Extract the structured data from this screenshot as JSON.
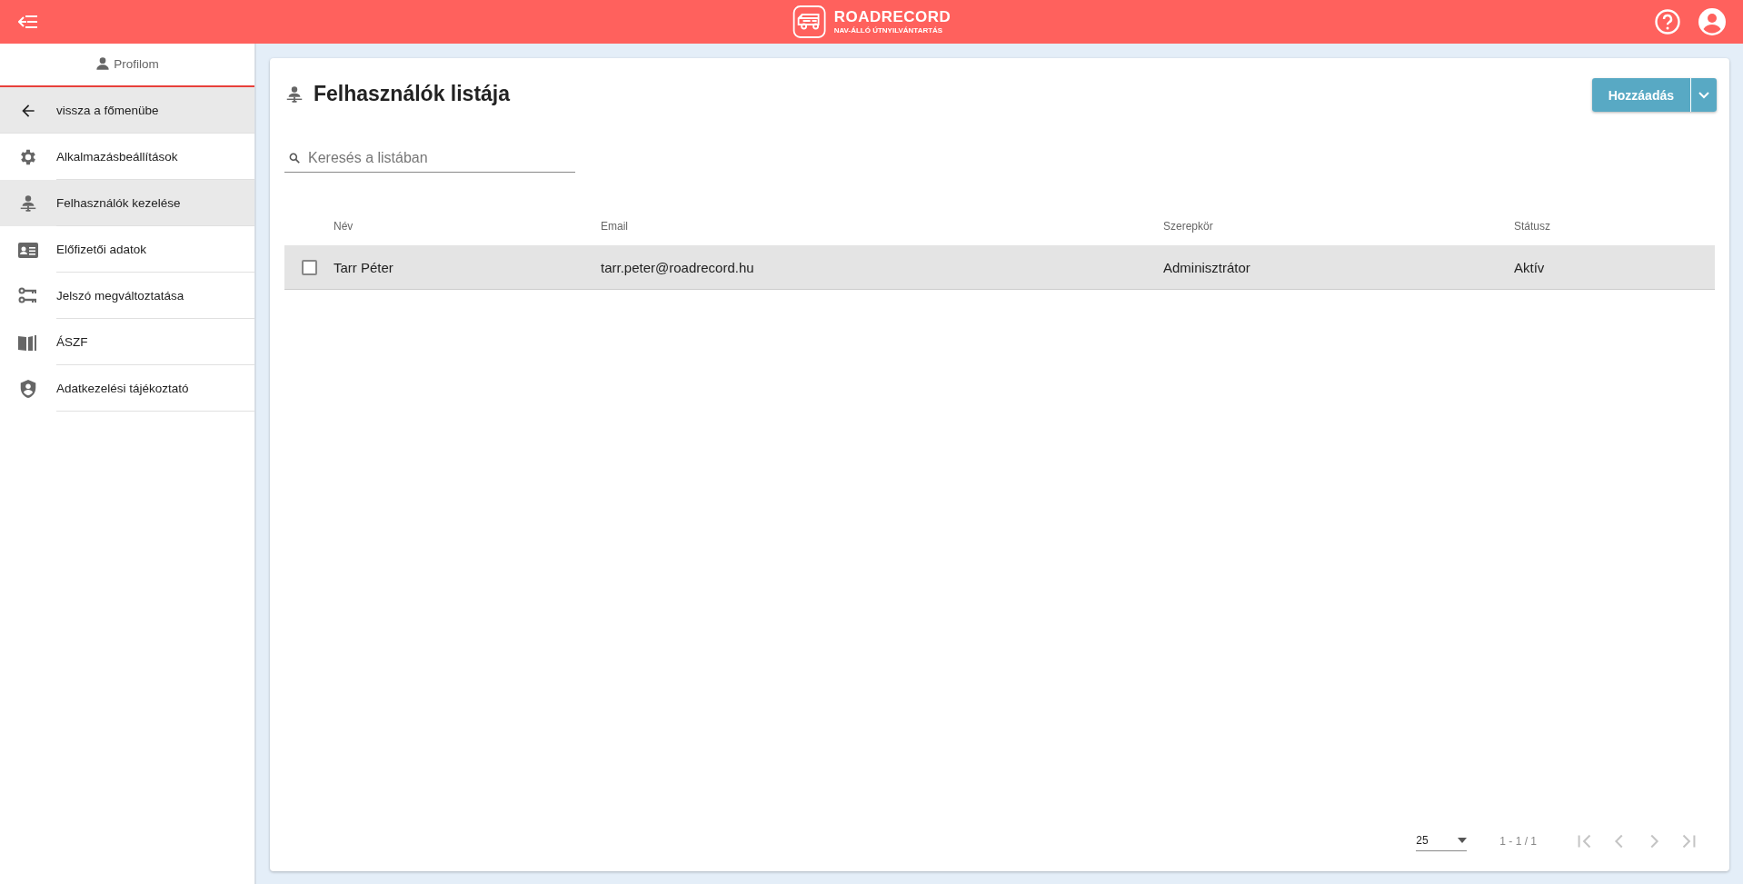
{
  "topbar": {
    "brand": "ROADRECORD",
    "tagline": "NAV-ÁLLÓ ÚTNYILVÁNTARTÁS"
  },
  "sidebar": {
    "header": "Profilom",
    "items": [
      {
        "label": "vissza a főmenübe",
        "kind": "back",
        "selected": true
      },
      {
        "label": "Alkalmazásbeállítások",
        "kind": "link",
        "selected": false
      },
      {
        "label": "Felhasználók kezelése",
        "kind": "link",
        "selected": true
      },
      {
        "label": "Előfizetői adatok",
        "kind": "link",
        "selected": false
      },
      {
        "label": "Jelszó megváltoztatása",
        "kind": "link",
        "selected": false
      },
      {
        "label": "ÁSZF",
        "kind": "link",
        "selected": false
      },
      {
        "label": "Adatkezelési tájékoztató",
        "kind": "link",
        "selected": false
      }
    ]
  },
  "page": {
    "title": "Felhasználók listája",
    "add_button": "Hozzáadás",
    "search": {
      "placeholder": "Keresés a listában"
    }
  },
  "table": {
    "columns": [
      "Név",
      "Email",
      "Szerepkör",
      "Státusz"
    ],
    "rows": [
      {
        "checked": false,
        "hovered": true,
        "cells": [
          "Tarr Péter",
          "tarr.peter@roadrecord.hu",
          "Adminisztrátor",
          "Aktív"
        ]
      }
    ]
  },
  "pagination": {
    "page_size": "25",
    "range": "1 - 1 / 1",
    "first_disabled": true,
    "prev_disabled": true,
    "next_disabled": true,
    "last_disabled": true
  }
}
